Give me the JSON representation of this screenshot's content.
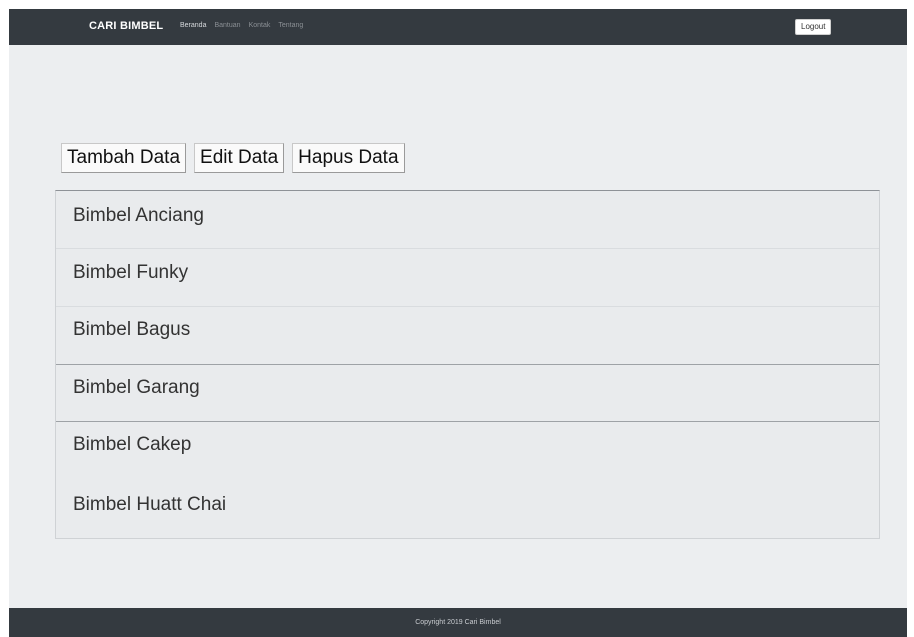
{
  "navbar": {
    "brand": "CARI BIMBEL",
    "links": [
      {
        "label": "Beranda",
        "active": true
      },
      {
        "label": "Bantuan",
        "active": false
      },
      {
        "label": "Kontak",
        "active": false
      },
      {
        "label": "Tentang",
        "active": false
      }
    ],
    "logout_label": "Logout"
  },
  "actions": {
    "add_label": "Tambah Data",
    "edit_label": "Edit Data",
    "delete_label": "Hapus Data"
  },
  "list": {
    "items": [
      "Bimbel Anciang",
      "Bimbel Funky",
      "Bimbel Bagus",
      "Bimbel Garang",
      "Bimbel Cakep",
      "Bimbel Huatt Chai"
    ]
  },
  "footer": {
    "copyright": "Copyright 2019 Cari Bimbel"
  },
  "colors": {
    "navbar_bg": "#343a40",
    "page_bg": "#eceef0",
    "footer_bg": "#343a40"
  }
}
